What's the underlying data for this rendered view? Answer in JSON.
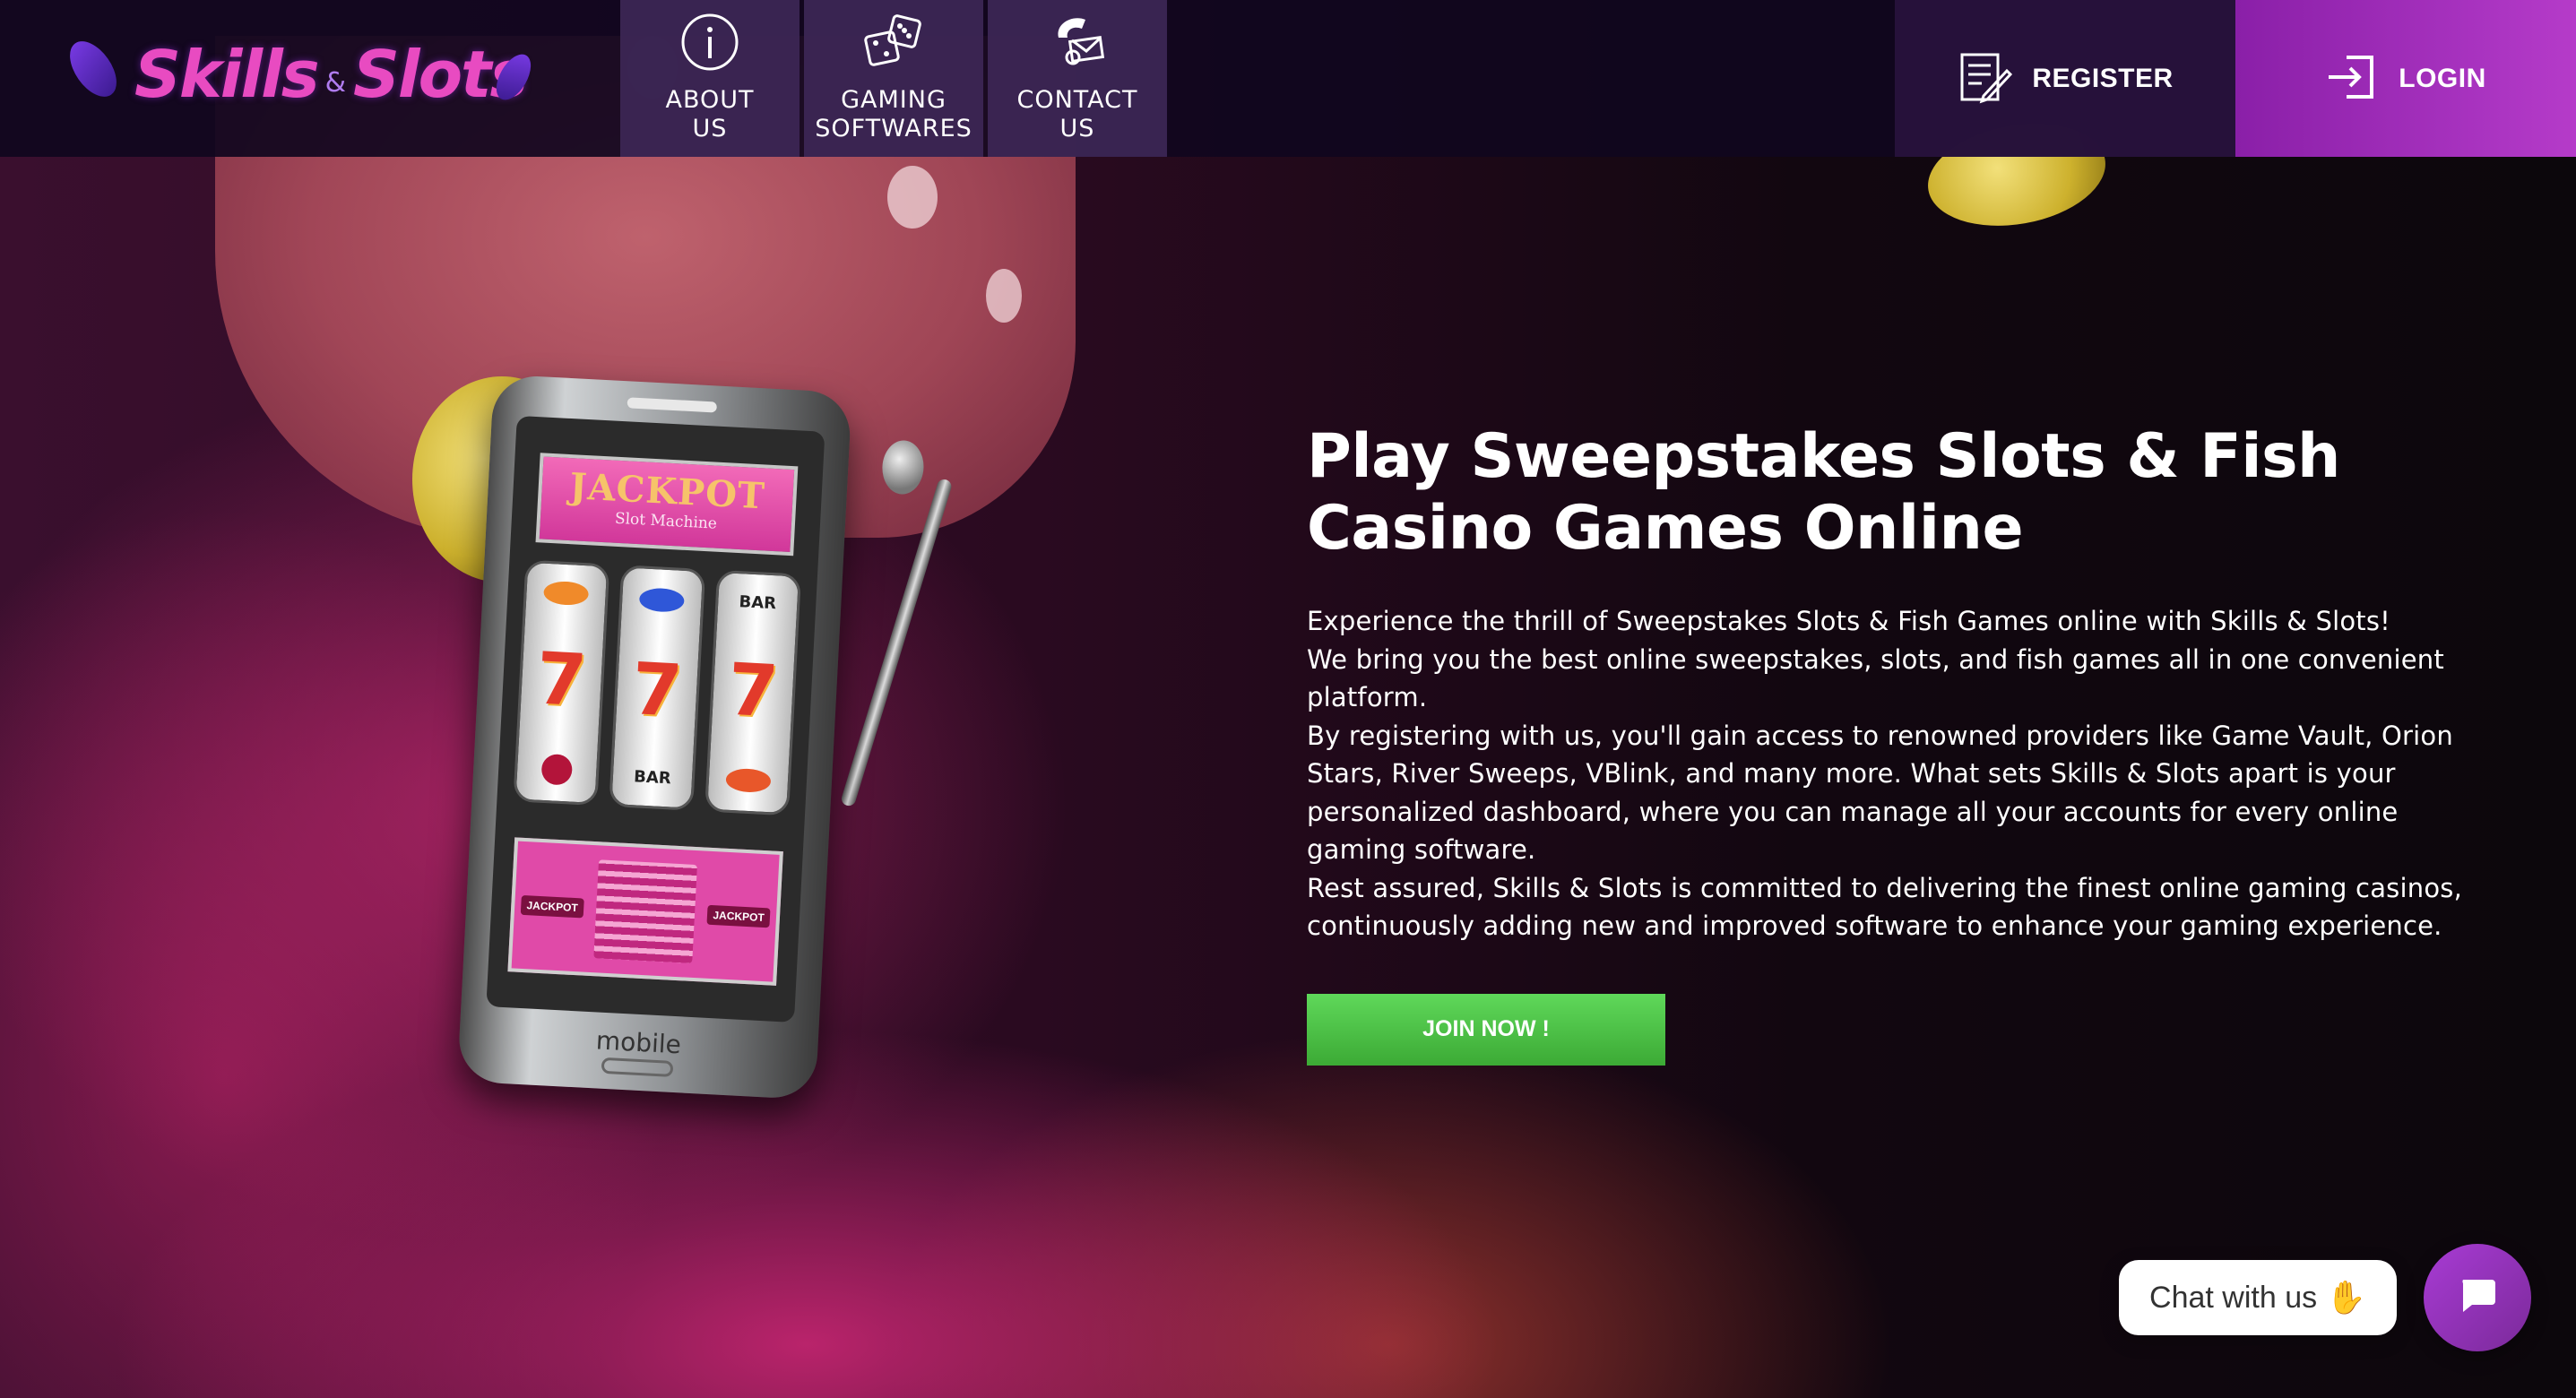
{
  "brand": {
    "logo_text_left": "Skills",
    "logo_amp": "&",
    "logo_text_right": "Slots",
    "accent_color": "#e84bc1"
  },
  "nav": {
    "items": [
      {
        "label": "ABOUT\nUS",
        "icon": "info-icon"
      },
      {
        "label": "GAMING\nSOFTWARES",
        "icon": "dice-icon"
      },
      {
        "label": "CONTACT\nUS",
        "icon": "phone-mail-icon"
      }
    ],
    "register_label": "REGISTER",
    "register_icon": "register-form-icon",
    "login_label": "LOGIN",
    "login_icon": "login-icon"
  },
  "phone_art": {
    "jackpot_title": "JACKPOT",
    "jackpot_sub": "Slot Machine",
    "reel_symbol": "7",
    "bar_label": "BAR",
    "paytable_badge": "JACKPOT",
    "brand": "mobile"
  },
  "hero": {
    "title": "Play Sweepstakes Slots & Fish Casino Games Online",
    "paragraphs": [
      "Experience the thrill of Sweepstakes Slots & Fish Games online with Skills & Slots!",
      "We bring you the best online sweepstakes, slots, and fish games all in one convenient platform.",
      "By registering with us, you'll gain access to renowned providers like Game Vault, Orion Stars, River Sweeps, VBlink, and many more. What sets Skills & Slots apart is your personalized dashboard, where you can manage all your accounts for every online gaming software.",
      "Rest assured, Skills & Slots is committed to delivering the finest online gaming casinos, continuously adding new and improved software to enhance your gaming experience."
    ],
    "cta_label": "JOIN NOW !",
    "cta_color": "#4cc545"
  },
  "chat": {
    "bubble_text": "Chat with us",
    "wave_icon": "waving-hand-icon",
    "launcher_icon": "chat-bubble-icon",
    "launcher_color": "#9b35c6"
  }
}
